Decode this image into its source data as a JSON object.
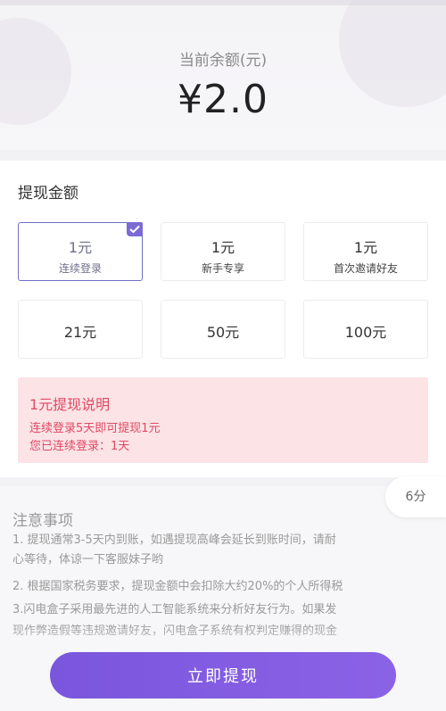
{
  "balance": {
    "label": "当前余额(元)",
    "value": "¥2.0"
  },
  "withdraw": {
    "title": "提现金额",
    "options": [
      {
        "amount": "1元",
        "sub": "连续登录",
        "selected": true
      },
      {
        "amount": "1元",
        "sub": "新手专享",
        "selected": false
      },
      {
        "amount": "1元",
        "sub": "首次邀请好友",
        "selected": false
      },
      {
        "amount": "21元",
        "sub": "",
        "selected": false
      },
      {
        "amount": "50元",
        "sub": "",
        "selected": false
      },
      {
        "amount": "100元",
        "sub": "",
        "selected": false
      }
    ]
  },
  "notice": {
    "title": "1元提现说明",
    "line1": "连续登录5天即可提现1元",
    "line2": "您已连续登录：1天"
  },
  "notes": {
    "title": "注意事项",
    "item1a": "1. 提现通常3-5天内到账，如遇提现高峰会延长到账时间，请耐",
    "item1b": "心等待，体谅一下客服妹子哟",
    "item2": "2. 根据国家税务要求，提现金额中会扣除大约20%的个人所得税",
    "item3a": "3.闪电盒子采用最先进的人工智能系统来分析好友行为。如果发",
    "item3b": "现作弊造假等违规邀请好友，闪电盒子系统有权判定赚得的现金"
  },
  "score_badge": "6分",
  "cta": "立即提现",
  "colors": {
    "accent": "#7a56dd",
    "notice_bg": "#fbe3e6",
    "notice_text": "#e04a63"
  }
}
